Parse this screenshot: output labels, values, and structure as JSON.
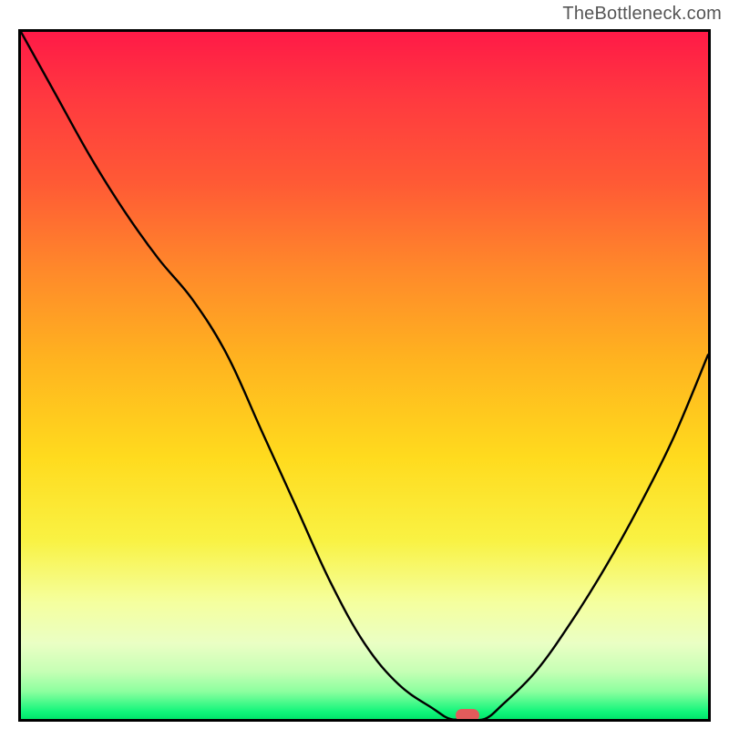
{
  "watermark": "TheBottleneck.com",
  "colors": {
    "frame_border": "#000000",
    "curve_stroke": "#000000",
    "marker_fill": "#e25b5b",
    "gradient_stops": [
      "#ff1a47",
      "#ff3a3f",
      "#ff5a35",
      "#ff8a2a",
      "#ffb41f",
      "#ffdb1e",
      "#f9f243",
      "#f5ff9e",
      "#eaffc4",
      "#c7ffb5",
      "#8cff9f",
      "#10f57a",
      "#00e56a"
    ]
  },
  "chart_data": {
    "type": "line",
    "title": "",
    "xlabel": "",
    "ylabel": "",
    "x": [
      0.0,
      0.05,
      0.1,
      0.15,
      0.2,
      0.25,
      0.3,
      0.35,
      0.4,
      0.45,
      0.5,
      0.55,
      0.6,
      0.625,
      0.65,
      0.675,
      0.7,
      0.75,
      0.8,
      0.85,
      0.9,
      0.95,
      1.0
    ],
    "values": [
      1.0,
      0.91,
      0.82,
      0.74,
      0.67,
      0.61,
      0.53,
      0.42,
      0.31,
      0.2,
      0.11,
      0.05,
      0.015,
      0.0,
      0.0,
      0.0,
      0.02,
      0.07,
      0.14,
      0.22,
      0.31,
      0.41,
      0.53
    ],
    "xlim": [
      0,
      1
    ],
    "ylim": [
      0,
      1
    ],
    "marker": {
      "x": 0.65,
      "y": 0.0
    },
    "note": "x and y are plot-fraction coordinates; axes are unlabeled in the source image."
  }
}
